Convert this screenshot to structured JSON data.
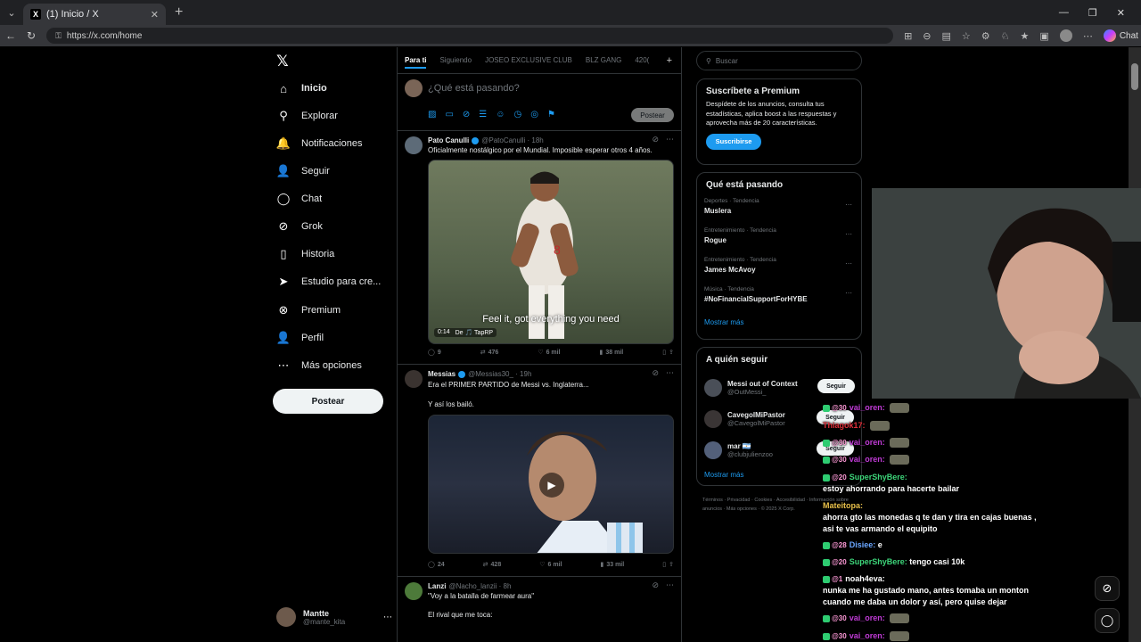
{
  "browser": {
    "tab_title": "(1) Inicio / X",
    "url": "https://x.com/home",
    "chat_label": "Chat"
  },
  "nav": {
    "items": [
      {
        "label": "Inicio",
        "icon": "home-icon",
        "glyph": "⌂"
      },
      {
        "label": "Explorar",
        "icon": "search-icon",
        "glyph": "⚲"
      },
      {
        "label": "Notificaciones",
        "icon": "bell-icon",
        "glyph": "🔔"
      },
      {
        "label": "Seguir",
        "icon": "add-person-icon",
        "glyph": "👤"
      },
      {
        "label": "Chat",
        "icon": "chat-bubble-icon",
        "glyph": "◯"
      },
      {
        "label": "Grok",
        "icon": "grok-icon",
        "glyph": "⊘"
      },
      {
        "label": "Historia",
        "icon": "bookmark-icon",
        "glyph": "▯"
      },
      {
        "label": "Estudio para cre...",
        "icon": "creator-studio-icon",
        "glyph": "➤"
      },
      {
        "label": "Premium",
        "icon": "premium-icon",
        "glyph": "⊗"
      },
      {
        "label": "Perfil",
        "icon": "profile-icon",
        "glyph": "👤"
      },
      {
        "label": "Más opciones",
        "icon": "more-options-icon",
        "glyph": "⋯"
      }
    ],
    "post_label": "Postear",
    "user_name": "Mantte",
    "user_handle": "@mante_kita"
  },
  "feed": {
    "tabs": [
      "Para ti",
      "Siguiendo",
      "JOSEO EXCLUSIVE CLUB",
      "BLZ GANG",
      "420("
    ],
    "composer_placeholder": "¿Qué está pasando?",
    "composer_post": "Postear",
    "tweets": [
      {
        "name": "Pato Canulli",
        "handle": "@PatoCanulli · 18h",
        "text": "Oficialmente nostálgico por el Mundial. Imposible esperar otros 4 años.",
        "caption": "Feel it, got everything you need",
        "video_time": "0:14",
        "video_credit": "De 🎵 TapRP",
        "replies": "9",
        "reposts": "476",
        "likes": "6 mil",
        "views": "38 mil"
      },
      {
        "name": "Messias",
        "handle": "@Messias30_ · 19h",
        "text": "Era el PRIMER PARTIDO de Messi vs. Inglaterra...",
        "text2": "Y así los bailó.",
        "replies": "24",
        "reposts": "428",
        "likes": "6 mil",
        "views": "33 mil"
      },
      {
        "name": "Lanzi",
        "handle": "@Nacho_lanzii · 8h",
        "text": "\"Voy a la batalla de farmear aura\"",
        "text2": "El rival que me toca:"
      }
    ]
  },
  "sidebar": {
    "search_placeholder": "Buscar",
    "premium_title": "Suscríbete a Premium",
    "premium_desc": "Despídete de los anuncios, consulta tus estadísticas, aplica boost a las respuestas y aprovecha más de 20 características.",
    "premium_button": "Suscribirse",
    "trends_title": "Qué está pasando",
    "trends": [
      {
        "category": "Deportes · Tendencia",
        "name": "Muslera"
      },
      {
        "category": "Entretenimiento · Tendencia",
        "name": "Rogue"
      },
      {
        "category": "Entretenimiento · Tendencia",
        "name": "James McAvoy"
      },
      {
        "category": "Música · Tendencia",
        "name": "#NoFinancialSupportForHYBE"
      }
    ],
    "show_more": "Mostrar más",
    "follow_title": "A quién seguir",
    "follow": [
      {
        "name": "Messi out of Context",
        "handle": "@OutMessi_",
        "button": "Seguir"
      },
      {
        "name": "CavegolMiPastor",
        "handle": "@CavegolMiPastor",
        "button": "Seguir"
      },
      {
        "name": "mar 🇦🇷",
        "handle": "@clubjulienzoo",
        "button": "Seguir"
      }
    ],
    "footer": "Términos · Privacidad · Cookies · Accesibilidad · Información sobre anuncios · Más opciones · © 2025 X Corp."
  },
  "stream_chat": [
    {
      "user": "vai_oren:",
      "color": "#c03bd6",
      "msg": "",
      "badge": "@30",
      "emote": true
    },
    {
      "user": "Thiagok17:",
      "color": "#e0303a",
      "msg": "",
      "badge": "",
      "emote": true
    },
    {
      "user": "vai_oren:",
      "color": "#c03bd6",
      "msg": "",
      "badge": "@30",
      "emote": true
    },
    {
      "user": "vai_oren:",
      "color": "#c03bd6",
      "msg": "",
      "badge": "@30",
      "emote": true
    },
    {
      "user": "SuperShyBere:",
      "color": "#3dd67a",
      "msg": "",
      "badge": "@20",
      "emote": false
    },
    {
      "user": "",
      "color": "#ffffff",
      "msg": "estoy ahorrando para hacerte bailar",
      "badge": "",
      "emote": false
    },
    {
      "user": "Mateitopa:",
      "color": "#e8c04a",
      "msg": "",
      "badge": "",
      "emote": false
    },
    {
      "user": "",
      "color": "#ffffff",
      "msg": "ahorra gto las monedas q te dan y tira en cajas buenas ,",
      "badge": "",
      "emote": false
    },
    {
      "user": "",
      "color": "#ffffff",
      "msg": "asi te vas armando el equipito",
      "badge": "",
      "emote": false
    },
    {
      "user": "Disiee:",
      "color": "#6aa6ff",
      "msg": "e",
      "badge": "@28",
      "emote": false
    },
    {
      "user": "SuperShyBere:",
      "color": "#3dd67a",
      "msg": "tengo casi 10k",
      "badge": "@20",
      "emote": false
    },
    {
      "user": "noah4eva:",
      "color": "#ffffff",
      "msg": "",
      "badge": "@1",
      "emote": false
    },
    {
      "user": "",
      "color": "#ffffff",
      "msg": "nunka me ha gustado mano, antes tomaba un monton",
      "badge": "",
      "emote": false
    },
    {
      "user": "",
      "color": "#ffffff",
      "msg": "cuando me daba un dolor y así, pero quise dejar",
      "badge": "",
      "emote": false
    },
    {
      "user": "vai_oren:",
      "color": "#c03bd6",
      "msg": "",
      "badge": "@30",
      "emote": true
    },
    {
      "user": "vai_oren:",
      "color": "#c03bd6",
      "msg": "",
      "badge": "@30",
      "emote": true
    }
  ]
}
